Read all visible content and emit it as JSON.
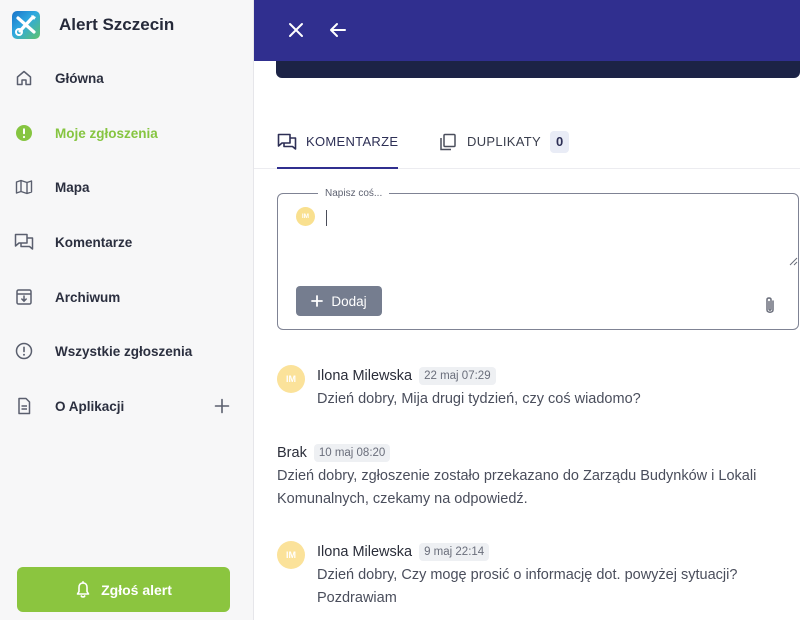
{
  "app": {
    "title": "Alert Szczecin"
  },
  "sidebar": {
    "items": [
      {
        "label": "Główna",
        "icon": "home-icon"
      },
      {
        "label": "Moje zgłoszenia",
        "icon": "alert-circle-filled-icon",
        "active": true
      },
      {
        "label": "Mapa",
        "icon": "map-icon"
      },
      {
        "label": "Komentarze",
        "icon": "comments-icon"
      },
      {
        "label": "Archiwum",
        "icon": "archive-icon"
      },
      {
        "label": "Wszystkie zgłoszenia",
        "icon": "alert-circle-icon"
      },
      {
        "label": "O Aplikacji",
        "icon": "document-icon"
      }
    ],
    "alert_button": "Zgłoś alert",
    "accent_color": "#86c541"
  },
  "tabs": [
    {
      "label": "KOMENTARZE",
      "icon": "comments-icon",
      "active": true
    },
    {
      "label": "DUPLIKATY",
      "icon": "copy-icon",
      "count": "0"
    }
  ],
  "compose": {
    "legend": "Napisz coś...",
    "avatar_initials": "IM",
    "value": "",
    "add_label": "Dodaj"
  },
  "comments": [
    {
      "initials": "IM",
      "author": "Ilona Milewska",
      "time": "22 maj 07:29",
      "text": "Dzień dobry, Mija drugi tydzień, czy coś wiadomo?"
    },
    {
      "initials": "",
      "author": "Brak",
      "time": "10 maj 08:20",
      "text": "Dzień dobry, zgłoszenie zostało przekazano do Zarządu Budynków i Lokali Komunalnych, czekamy na odpowiedź."
    },
    {
      "initials": "IM",
      "author": "Ilona Milewska",
      "time": "9 maj 22:14",
      "text": "Dzień dobry, Czy mogę prosić o informację dot. powyżej sytuacji? Pozdrawiam"
    }
  ],
  "colors": {
    "topbar": "#302f8f",
    "primary_text": "#2b2f3f"
  }
}
